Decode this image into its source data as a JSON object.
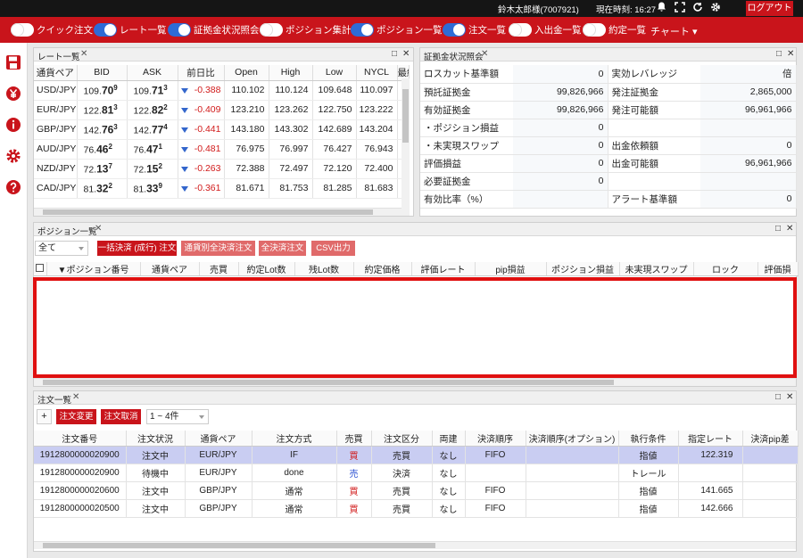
{
  "topbar": {
    "user": "鈴木太郎様(7007921)",
    "time": "現在時刻: 16:27",
    "logout": "ログアウト"
  },
  "toolbar": {
    "toggles": [
      {
        "label": "クイック注文",
        "on": false
      },
      {
        "label": "レート一覧",
        "on": true
      },
      {
        "label": "証拠金状況照会",
        "on": true
      },
      {
        "label": "ポジション集計",
        "on": false
      },
      {
        "label": "ポジション一覧",
        "on": true
      },
      {
        "label": "注文一覧",
        "on": true
      },
      {
        "label": "入出金一覧",
        "on": false
      },
      {
        "label": "約定一覧",
        "on": false
      }
    ],
    "chart": "チャート ▾"
  },
  "rate_panel": {
    "title": "レート一覧",
    "headers": [
      "通貨ペア",
      "BID",
      "ASK",
      "前日比",
      "Open",
      "High",
      "Low",
      "NYCL",
      "最終"
    ],
    "rows": [
      {
        "pair": "USD/JPY",
        "bid_a": "109.",
        "bid_b": "70",
        "bid_c": "9",
        "ask_a": "109.",
        "ask_b": "71",
        "ask_c": "3",
        "chg": "-0.388",
        "open": "110.102",
        "high": "110.124",
        "low": "109.648",
        "nycl": "110.097"
      },
      {
        "pair": "EUR/JPY",
        "bid_a": "122.",
        "bid_b": "81",
        "bid_c": "3",
        "ask_a": "122.",
        "ask_b": "82",
        "ask_c": "2",
        "chg": "-0.409",
        "open": "123.210",
        "high": "123.262",
        "low": "122.750",
        "nycl": "123.222"
      },
      {
        "pair": "GBP/JPY",
        "bid_a": "142.",
        "bid_b": "76",
        "bid_c": "3",
        "ask_a": "142.",
        "ask_b": "77",
        "ask_c": "4",
        "chg": "-0.441",
        "open": "143.180",
        "high": "143.302",
        "low": "142.689",
        "nycl": "143.204"
      },
      {
        "pair": "AUD/JPY",
        "bid_a": "76.",
        "bid_b": "46",
        "bid_c": "2",
        "ask_a": "76.",
        "ask_b": "47",
        "ask_c": "1",
        "chg": "-0.481",
        "open": "76.975",
        "high": "76.997",
        "low": "76.427",
        "nycl": "76.943"
      },
      {
        "pair": "NZD/JPY",
        "bid_a": "72.",
        "bid_b": "13",
        "bid_c": "7",
        "ask_a": "72.",
        "ask_b": "15",
        "ask_c": "2",
        "chg": "-0.263",
        "open": "72.388",
        "high": "72.497",
        "low": "72.120",
        "nycl": "72.400"
      },
      {
        "pair": "CAD/JPY",
        "bid_a": "81.",
        "bid_b": "32",
        "bid_c": "2",
        "ask_a": "81.",
        "ask_b": "33",
        "ask_c": "9",
        "chg": "-0.361",
        "open": "81.671",
        "high": "81.753",
        "low": "81.285",
        "nycl": "81.683"
      }
    ]
  },
  "margin_panel": {
    "title": "証拠金状況照会",
    "rows": [
      [
        "ロスカット基準額",
        "0",
        "実効レバレッジ",
        "倍"
      ],
      [
        "預託証拠金",
        "99,826,966",
        "発注証拠金",
        "2,865,000"
      ],
      [
        "有効証拠金",
        "99,826,966",
        "発注可能額",
        "96,961,966"
      ],
      [
        "・ポジション損益",
        "0",
        "",
        ""
      ],
      [
        "・未実現スワップ",
        "0",
        "出金依頼額",
        "0"
      ],
      [
        "評価損益",
        "0",
        "出金可能額",
        "96,961,966"
      ],
      [
        "必要証拠金",
        "0",
        "",
        ""
      ],
      [
        "有効比率（%）",
        "",
        "アラート基準額",
        "0"
      ]
    ]
  },
  "position_panel": {
    "title": "ポジション一覧",
    "filter": "全て",
    "buttons": [
      "一括決済 (成行) 注文",
      "通貨別全決済注文",
      "全決済注文",
      "CSV出力"
    ],
    "headers": [
      "▼ポジション番号",
      "通貨ペア",
      "売買",
      "約定Lot数",
      "残Lot数",
      "約定価格",
      "評価レート",
      "pip損益",
      "ポジション損益",
      "未実現スワップ",
      "ロック",
      "評価損"
    ]
  },
  "order_panel": {
    "title": "注文一覧",
    "add": "+",
    "change": "注文変更",
    "cancel": "注文取消",
    "range": "1 ~ 4件",
    "headers": [
      "注文番号",
      "注文状況",
      "通貨ペア",
      "注文方式",
      "売買",
      "注文区分",
      "両建",
      "決済順序",
      "決済順序(オプション)",
      "執行条件",
      "指定レート",
      "決済pip差"
    ],
    "rows": [
      {
        "no": "1912800000020900",
        "status": "注文中",
        "pair": "EUR/JPY",
        "method": "IF",
        "side": "買",
        "side_type": "buy",
        "kind": "売買",
        "hedge": "なし",
        "order": "FIFO",
        "opt": "",
        "cond": "指値",
        "rate": "122.319",
        "pip": ""
      },
      {
        "no": "1912800000020900",
        "status": "待機中",
        "pair": "EUR/JPY",
        "method": "done",
        "side": "売",
        "side_type": "sell",
        "kind": "決済",
        "hedge": "なし",
        "order": "",
        "opt": "",
        "cond": "トレール",
        "rate": "",
        "pip": ""
      },
      {
        "no": "1912800000020600",
        "status": "注文中",
        "pair": "GBP/JPY",
        "method": "通常",
        "side": "買",
        "side_type": "buy",
        "kind": "売買",
        "hedge": "なし",
        "order": "FIFO",
        "opt": "",
        "cond": "指値",
        "rate": "141.665",
        "pip": ""
      },
      {
        "no": "1912800000020500",
        "status": "注文中",
        "pair": "GBP/JPY",
        "method": "通常",
        "side": "買",
        "side_type": "buy",
        "kind": "売買",
        "hedge": "なし",
        "order": "FIFO",
        "opt": "",
        "cond": "指値",
        "rate": "142.666",
        "pip": ""
      }
    ]
  },
  "colors": {
    "brand_red": "#c9141b",
    "highlight_row": "#c9cdf2",
    "toggle_on": "#2e6bd6"
  }
}
